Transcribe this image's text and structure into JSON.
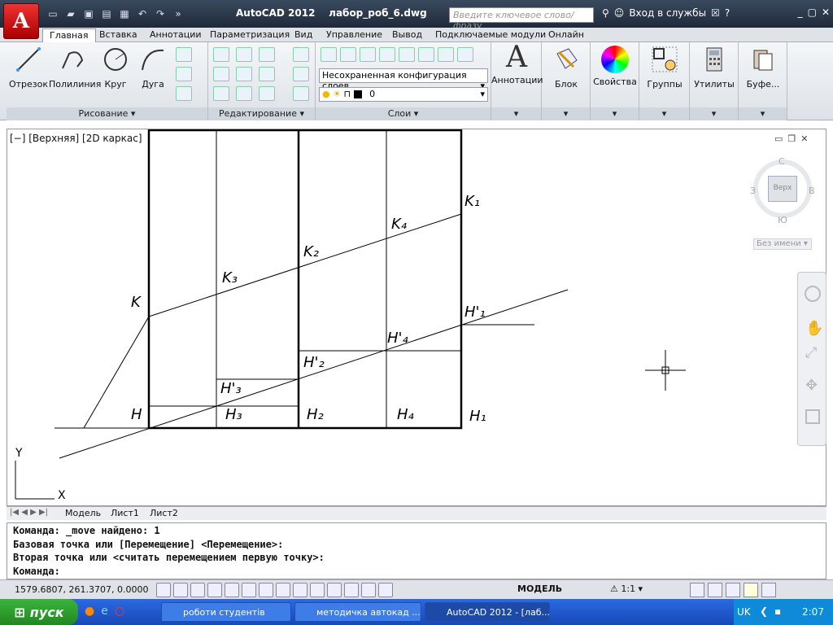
{
  "app": {
    "logo_letter": "A",
    "title": "AutoCAD 2012",
    "filename": "лабор_роб_6.dwg"
  },
  "search": {
    "placeholder": "Введите ключевое слово/фразу"
  },
  "title_right": {
    "login": "Вход в службы"
  },
  "ribbon_tabs": [
    "Главная",
    "Вставка",
    "Аннотации",
    "Параметризация",
    "Вид",
    "Управление",
    "Вывод",
    "Подключаемые модули",
    "Онлайн"
  ],
  "draw_tools": [
    "Отрезок",
    "Полилиния",
    "Круг",
    "Дуга"
  ],
  "panels": {
    "draw": "Рисование",
    "modify": "Редактирование",
    "layers": "Слои"
  },
  "layer": {
    "state": "Несохраненная конфигурация слоев",
    "current": "0"
  },
  "big_tools": [
    "Аннотации",
    "Блок",
    "Свойства",
    "Группы",
    "Утилиты",
    "Буфе..."
  ],
  "viewport_label": "[−] [Верхняя] [2D каркас]",
  "viewcube": {
    "face": "Верх",
    "north": "С",
    "south": "Ю",
    "east": "В",
    "west": "З",
    "ucs": "Без имени"
  },
  "ucs_labels": {
    "y": "Y",
    "x": "X"
  },
  "drawing_labels": {
    "K": "K",
    "K1": "K₁",
    "K2": "K₂",
    "K3": "K₃",
    "K4": "K₄",
    "H": "H",
    "H1": "H₁",
    "H2": "H₂",
    "H3": "H₃",
    "H4": "H₄",
    "Hp1": "H'₁",
    "Hp2": "H'₂",
    "Hp3": "H'₃",
    "Hp4": "H'₄"
  },
  "layout_tabs": [
    "Модель",
    "Лист1",
    "Лист2"
  ],
  "command_lines": [
    "Команда: _move найдено: 1",
    "Базовая точка или [Перемещение] <Перемещение>:",
    "Вторая точка или <считать перемещением первую точку>:",
    "Команда:"
  ],
  "status": {
    "coords": "1579.6807, 261.3707, 0.0000",
    "model": "МОДЕЛЬ",
    "scale": "1:1"
  },
  "taskbar": {
    "start": "пуск",
    "items": [
      "роботи студентів",
      "методичка автокад ...",
      "AutoCAD 2012 - [лаб..."
    ],
    "lang": "UK",
    "time": "2:07"
  }
}
